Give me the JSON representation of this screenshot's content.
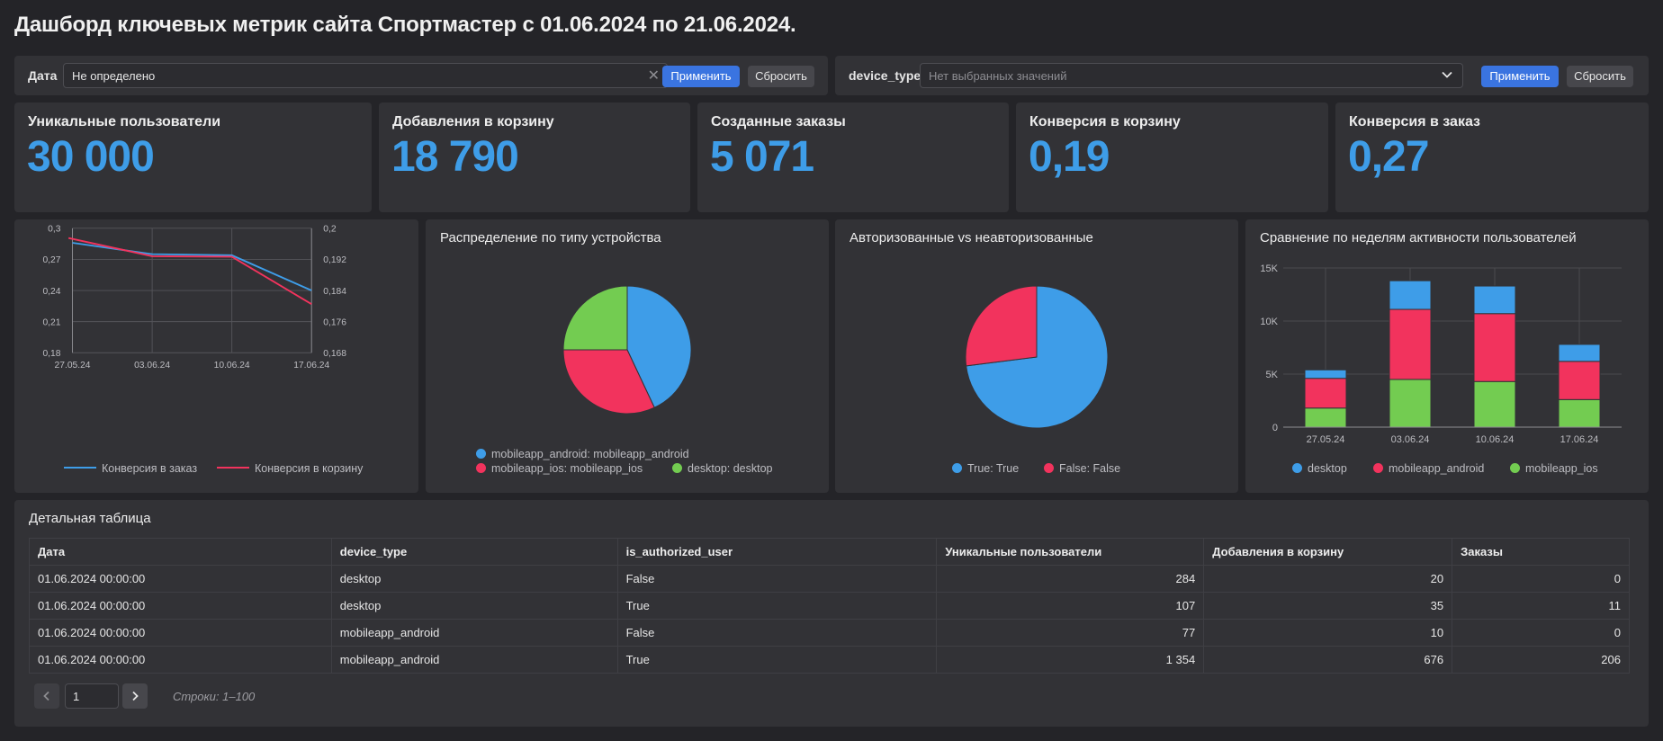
{
  "page": {
    "title": "Дашборд ключевых метрик сайта Спортмастер с 01.06.2024 по 21.06.2024."
  },
  "filters": {
    "date": {
      "label": "Дата",
      "value": "Не определено",
      "apply": "Применить",
      "reset": "Сбросить"
    },
    "device_type": {
      "label": "device_type",
      "placeholder": "Нет выбранных значений",
      "apply": "Применить",
      "reset": "Сбросить"
    }
  },
  "kpis": [
    {
      "title": "Уникальные пользователи",
      "value": "30 000"
    },
    {
      "title": "Добавления в корзину",
      "value": "18 790"
    },
    {
      "title": "Созданные заказы",
      "value": "5 071"
    },
    {
      "title": "Конверсия в корзину",
      "value": "0,19"
    },
    {
      "title": "Конверсия в заказ",
      "value": "0,27"
    }
  ],
  "colors": {
    "blue": "#3e9de8",
    "red": "#f2335d",
    "green": "#73cc51",
    "kpi": "#3e9de8",
    "primary_button": "#3a74e0"
  },
  "chart_data": [
    {
      "type": "line",
      "title": "",
      "x": [
        "27.05.24",
        "03.06.24",
        "10.06.24",
        "17.06.24"
      ],
      "y_left": {
        "ticks": [
          "0,3",
          "0,27",
          "0,24",
          "0,21",
          "0,18"
        ],
        "ylim": [
          0.18,
          0.3
        ]
      },
      "y_right": {
        "ticks": [
          "0,2",
          "0,192",
          "0,184",
          "0,176",
          "0,168"
        ],
        "ylim": [
          0.168,
          0.2
        ]
      },
      "series": [
        {
          "name": "Конверсия в заказ",
          "axis": "left",
          "color": "#3e9de8",
          "points": [
            [
              0,
              0.286
            ],
            [
              1,
              0.275
            ],
            [
              2,
              0.274
            ],
            [
              3,
              0.24
            ]
          ]
        },
        {
          "name": "Конверсия в корзину",
          "axis": "right",
          "color": "#f2335d",
          "points": [
            [
              -0.05,
              0.1975
            ],
            [
              1,
              0.1928
            ],
            [
              2,
              0.1927
            ],
            [
              3,
              0.1805
            ]
          ]
        }
      ],
      "grid": true,
      "legend": "bottom"
    },
    {
      "type": "pie",
      "title": "Распределение по типу устройства",
      "slices": [
        {
          "name": "mobileapp_android: mobileapp_android",
          "value": 43,
          "color": "#3e9de8"
        },
        {
          "name": "mobileapp_ios: mobileapp_ios",
          "value": 32,
          "color": "#f2335d"
        },
        {
          "name": "desktop: desktop",
          "value": 25,
          "color": "#73cc51"
        }
      ],
      "legend": "bottom"
    },
    {
      "type": "pie",
      "title": "Авторизованные vs неавторизованные",
      "slices": [
        {
          "name": "True: True",
          "value": 73,
          "color": "#3e9de8"
        },
        {
          "name": "False: False",
          "value": 27,
          "color": "#f2335d"
        }
      ],
      "legend": "bottom"
    },
    {
      "type": "bar",
      "stacked": true,
      "title": "Сравнение по неделям активности пользователей",
      "categories": [
        "27.05.24",
        "03.06.24",
        "10.06.24",
        "17.06.24"
      ],
      "y_ticks": [
        "15K",
        "10K",
        "5K",
        "0"
      ],
      "ylim": [
        0,
        15000
      ],
      "series": [
        {
          "name": "mobileapp_ios",
          "color": "#73cc51",
          "values": [
            1800,
            4500,
            4300,
            2600
          ]
        },
        {
          "name": "mobileapp_android",
          "color": "#f2335d",
          "values": [
            2800,
            6600,
            6400,
            3600
          ]
        },
        {
          "name": "desktop",
          "color": "#3e9de8",
          "values": [
            800,
            2700,
            2600,
            1600
          ]
        }
      ],
      "legend_order": [
        "desktop",
        "mobileapp_android",
        "mobileapp_ios"
      ],
      "grid": true,
      "legend": "bottom"
    }
  ],
  "table": {
    "title": "Детальная таблица",
    "columns": [
      "Дата",
      "device_type",
      "is_authorized_user",
      "Уникальные пользователи",
      "Добавления в корзину",
      "Заказы"
    ],
    "rows": [
      [
        "01.06.2024 00:00:00",
        "desktop",
        "False",
        "284",
        "20",
        "0"
      ],
      [
        "01.06.2024 00:00:00",
        "desktop",
        "True",
        "107",
        "35",
        "11"
      ],
      [
        "01.06.2024 00:00:00",
        "mobileapp_android",
        "False",
        "77",
        "10",
        "0"
      ],
      [
        "01.06.2024 00:00:00",
        "mobileapp_android",
        "True",
        "1 354",
        "676",
        "206"
      ]
    ],
    "pagination": {
      "page": "1",
      "rows_info": "Строки: 1–100"
    }
  }
}
